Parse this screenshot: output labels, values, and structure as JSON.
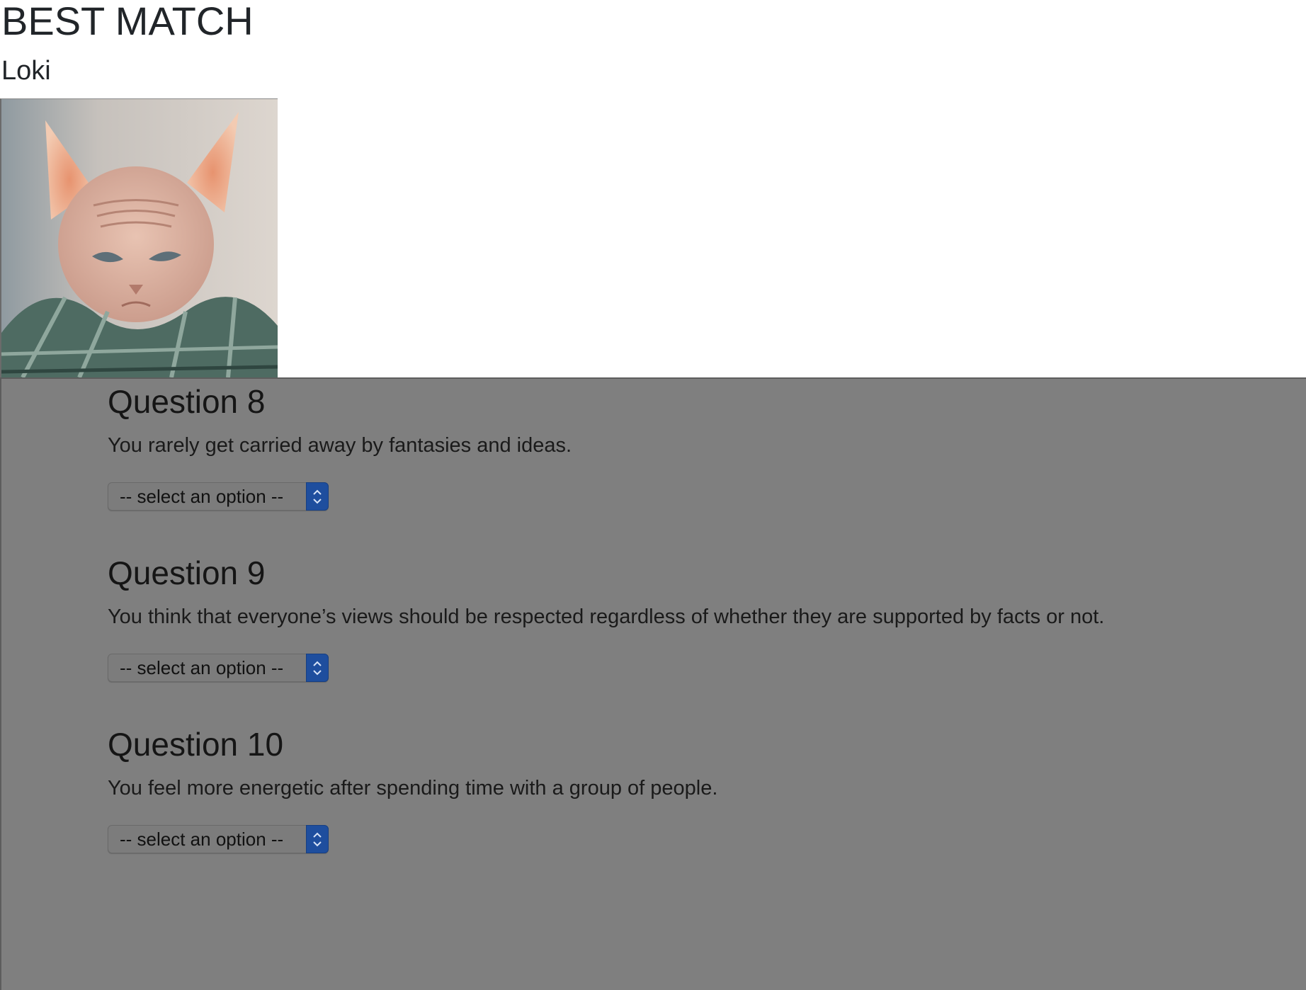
{
  "match": {
    "title": "BEST MATCH",
    "name": "Loki",
    "photo_icon": "sphynx-cat-photo"
  },
  "questions": [
    {
      "heading": "Question 8",
      "text": "You rarely get carried away by fantasies and ideas.",
      "select_value": "-- select an option --"
    },
    {
      "heading": "Question 9",
      "text": "You think that everyone’s views should be respected regardless of whether they are supported by facts or not.",
      "select_value": "-- select an option --"
    },
    {
      "heading": "Question 10",
      "text": "You feel more energetic after spending time with a group of people.",
      "select_value": "-- select an option --"
    }
  ],
  "colors": {
    "overlay": "#7f7f7f",
    "select_accent": "#1e4e9e",
    "page_background": "#ffffff"
  }
}
